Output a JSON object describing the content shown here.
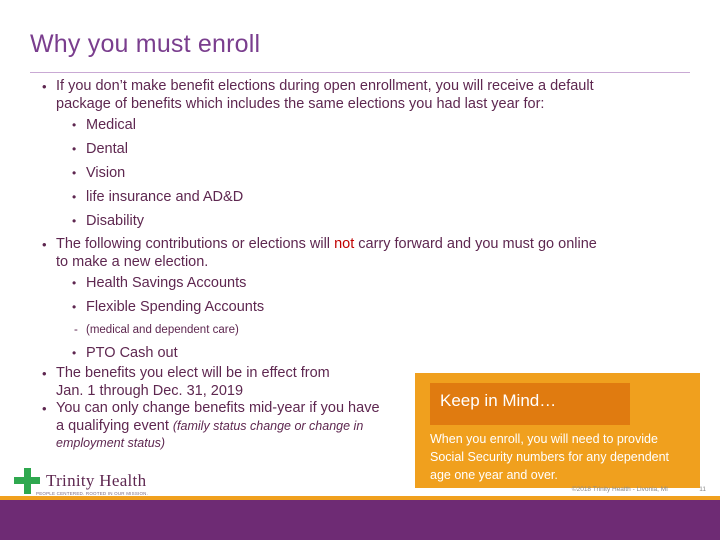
{
  "slide": {
    "title": "Why you must enroll",
    "bullets": {
      "b1_line1": "If you don’t make benefit elections during open enrollment, you will receive a default",
      "b1_line2": "package of benefits which includes the same elections you had last year for:",
      "b1_sub": [
        "Medical",
        "Dental",
        "Vision",
        "life insurance and AD&D",
        "Disability"
      ],
      "b2_pre": "The following contributions or elections will ",
      "b2_red": "not",
      "b2_post": " carry forward and you must go online",
      "b2_line2": "to make a new election.",
      "b2_sub": [
        "Health Savings Accounts",
        "Flexible Spending Accounts"
      ],
      "b2_sub_note": "(medical and dependent care)",
      "b2_sub_last": "PTO Cash out",
      "b3_line1": "The benefits you elect will be in effect from",
      "b3_line2": "Jan. 1 through Dec. 31, 2019",
      "b4_line1": "You can only change benefits mid-year if you have",
      "b4_line2_pre": "a qualifying event ",
      "b4_line2_ital": "(family status change or change in",
      "b4_line3_ital": "employment status)"
    },
    "keep_in_mind": {
      "title": "Keep in Mind…",
      "text": "When you enroll, you will need to provide Social Security numbers for any dependent age one year and over."
    },
    "footer": {
      "logo_text": "Trinity Health",
      "logo_subtext": "PEOPLE CENTERED. ROOTED IN OUR MISSION.",
      "copyright": "©2018 Trinity Health - Livonia, MI",
      "page_number": "11"
    },
    "colors": {
      "title_purple": "#7A3E8E",
      "body_purple": "#5E2750",
      "accent_orange": "#F0A01E",
      "accent_orange_dark": "#E07B10",
      "footer_purple": "#6E2B74",
      "red": "#C00000",
      "logo_green": "#2FA84F"
    }
  }
}
